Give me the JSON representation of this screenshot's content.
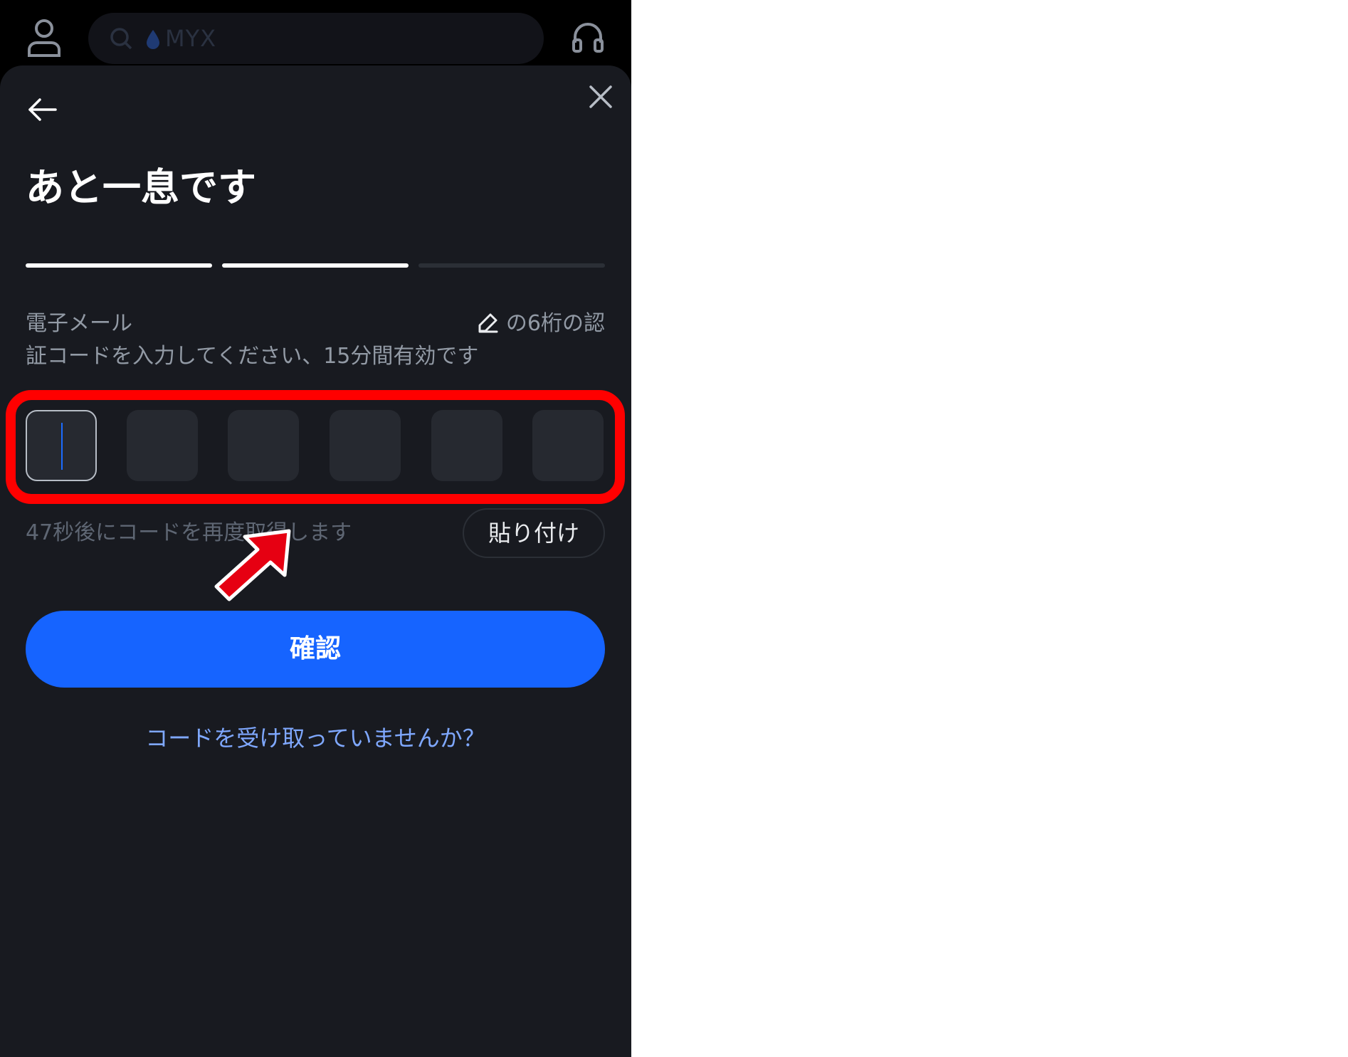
{
  "topbar": {
    "search_placeholder": "MYX"
  },
  "sheet": {
    "title": "あと一息です",
    "progress": {
      "total_steps": 3,
      "completed_steps": 2
    },
    "description": {
      "email_label": "電子メール",
      "edit_text": "の6桁の認",
      "line2": "証コードを入力してください、15分間有効です"
    },
    "code_boxes": [
      "",
      "",
      "",
      "",
      "",
      ""
    ],
    "resend_text": "47秒後にコードを再度取得します",
    "paste_label": "貼り付け",
    "confirm_label": "確認",
    "no_code_link": "コードを受け取っていませんか？"
  },
  "colors": {
    "background": "#181a20",
    "accent": "#1664ff",
    "highlight": "#ff0000",
    "link": "#7fa8ff",
    "progress_done": "#ffffff",
    "progress_todo": "#2b2f36"
  },
  "icons": [
    "user-icon",
    "search-icon",
    "drop-icon",
    "headset-icon",
    "back-arrow-icon",
    "close-icon",
    "pencil-icon",
    "pointer-arrow-icon"
  ]
}
